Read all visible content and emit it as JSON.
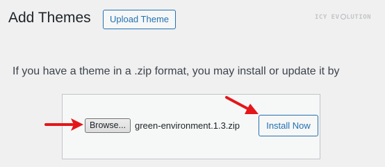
{
  "header": {
    "title": "Add Themes",
    "upload_button_label": "Upload Theme"
  },
  "watermark": {
    "text_left": "ICY EV",
    "text_right": "LUTION"
  },
  "upload_form": {
    "instructions": "If you have a theme in a .zip format, you may install or update it by",
    "browse_button_label": "Browse...",
    "selected_file": "green-environment.1.3.zip",
    "install_button_label": "Install Now"
  },
  "annotations": {
    "arrow_color": "#e3171a"
  },
  "colors": {
    "accent": "#2271b1",
    "background": "#f0f0f1"
  }
}
